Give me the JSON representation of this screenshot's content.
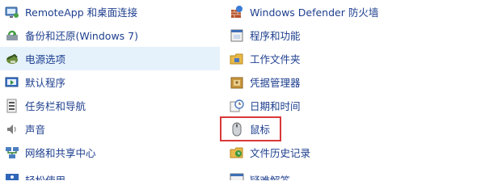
{
  "left_items": [
    {
      "label": "RemoteApp 和桌面连接",
      "icon": "remoteapp-icon"
    },
    {
      "label": "备份和还原(Windows 7)",
      "icon": "backup-restore-icon"
    },
    {
      "label": "电源选项",
      "icon": "power-options-icon"
    },
    {
      "label": "默认程序",
      "icon": "default-programs-icon"
    },
    {
      "label": "任务栏和导航",
      "icon": "taskbar-navigation-icon"
    },
    {
      "label": "声音",
      "icon": "sound-icon"
    },
    {
      "label": "网络和共享中心",
      "icon": "network-sharing-icon"
    },
    {
      "label": "轻松使用",
      "icon": "ease-of-access-icon"
    }
  ],
  "right_items": [
    {
      "label": "Windows Defender 防火墙",
      "icon": "firewall-icon"
    },
    {
      "label": "程序和功能",
      "icon": "programs-features-icon"
    },
    {
      "label": "工作文件夹",
      "icon": "work-folders-icon"
    },
    {
      "label": "凭据管理器",
      "icon": "credential-manager-icon"
    },
    {
      "label": "日期和时间",
      "icon": "date-time-icon"
    },
    {
      "label": "鼠标",
      "icon": "mouse-icon"
    },
    {
      "label": "文件历史记录",
      "icon": "file-history-icon"
    },
    {
      "label": "疑难解答",
      "icon": "troubleshooting-icon"
    }
  ],
  "state": {
    "hovered_item": "电源选项",
    "highlighted_item": "鼠标",
    "highlight_color": "#d9383a",
    "hover_color": "#e5f1fb",
    "link_color": "#1e3f8f"
  }
}
